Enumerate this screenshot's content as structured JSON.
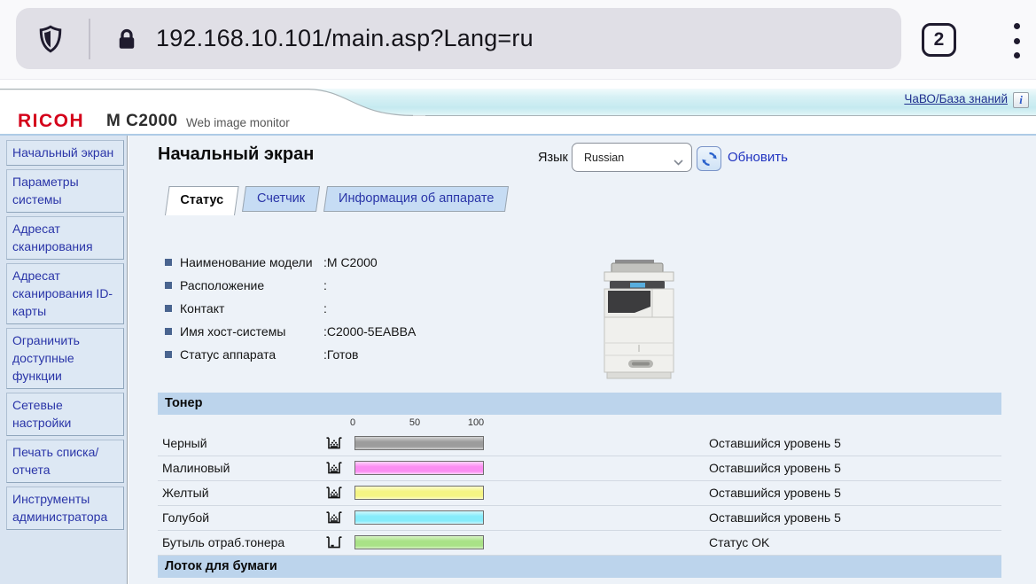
{
  "browser": {
    "url": "192.168.10.101/main.asp?Lang=ru",
    "tab_count": "2"
  },
  "header": {
    "help_link": "ЧаВО/База знаний",
    "info_button": "i",
    "brand": "RICOH",
    "model": "M C2000",
    "app_name": "Web image monitor"
  },
  "sidebar": {
    "items": [
      {
        "label": "Начальный экран"
      },
      {
        "label": "Параметры системы"
      },
      {
        "label": "Адресат сканирования"
      },
      {
        "label": "Адресат сканирования ID-карты"
      },
      {
        "label": "Ограничить доступные функции"
      },
      {
        "label": "Сетевые настройки"
      },
      {
        "label": "Печать списка/отчета"
      },
      {
        "label": "Инструменты администратора"
      }
    ]
  },
  "main": {
    "title": "Начальный экран",
    "language": {
      "label": "Язык",
      "value": "Russian"
    },
    "refresh_label": "Обновить",
    "tabs": [
      {
        "label": "Статус",
        "active": true
      },
      {
        "label": "Счетчик",
        "active": false
      },
      {
        "label": "Информация об аппарате",
        "active": false
      }
    ],
    "device_info": [
      {
        "label": "Наименование модели",
        "value": ":M C2000"
      },
      {
        "label": "Расположение",
        "value": ":"
      },
      {
        "label": "Контакт",
        "value": ":"
      },
      {
        "label": "Имя хост-системы",
        "value": ":C2000-5EABBA"
      },
      {
        "label": "Статус аппарата",
        "value": ":Готов"
      }
    ],
    "toner": {
      "section_title": "Тонер",
      "scale": [
        "0",
        "50",
        "100"
      ],
      "rows": [
        {
          "label": "Черный",
          "status": "Оставшийся уровень 5",
          "color": "#9c9c9c",
          "color_light": "#d4d4d4",
          "icon": "toner-cartridge"
        },
        {
          "label": "Малиновый",
          "status": "Оставшийся уровень 5",
          "color": "#fb8df2",
          "color_light": "#ffd4fb",
          "icon": "toner-cartridge"
        },
        {
          "label": "Желтый",
          "status": "Оставшийся уровень 5",
          "color": "#f5f584",
          "color_light": "#fcfccb",
          "icon": "toner-cartridge"
        },
        {
          "label": "Голубой",
          "status": "Оставшийся уровень 5",
          "color": "#86ecfb",
          "color_light": "#cdf8fe",
          "icon": "toner-cartridge"
        },
        {
          "label": "Бутыль отраб.тонера",
          "status": "Статус OK",
          "color": "#a9e287",
          "color_light": "#d8f3c5",
          "icon": "waste-bottle"
        }
      ]
    },
    "paper_tray_title": "Лоток для бумаги"
  },
  "colors": {
    "band_blue": "#bcd4ec",
    "page_bg": "#edf2f8",
    "sidebar_bg": "#d9e4f1",
    "link_blue": "#2a35a8",
    "accent_link": "#2033c0",
    "brand_red": "#d4001a",
    "cyan_band": "#c5eaf0",
    "chrome_dark": "#1f1b2e"
  }
}
